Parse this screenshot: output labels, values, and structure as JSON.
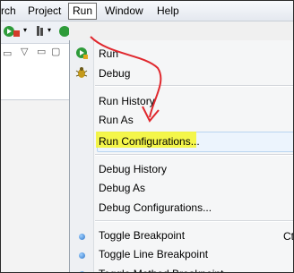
{
  "menubar": {
    "items": [
      {
        "label": "rch"
      },
      {
        "label": "Project"
      },
      {
        "label": "Run"
      },
      {
        "label": "Window"
      },
      {
        "label": "Help"
      }
    ]
  },
  "run_menu": {
    "groups": [
      [
        {
          "label": "Run",
          "icon": "run-icon"
        },
        {
          "label": "Debug",
          "icon": "debug-bug-icon"
        }
      ],
      [
        {
          "label": "Run History"
        },
        {
          "label": "Run As"
        },
        {
          "label": "Run Configurations...",
          "highlighted": true
        }
      ],
      [
        {
          "label": "Debug History"
        },
        {
          "label": "Debug As"
        },
        {
          "label": "Debug Configurations..."
        }
      ],
      [
        {
          "label": "Toggle Breakpoint",
          "accel": "Ct",
          "icon": "breakpoint-icon"
        },
        {
          "label": "Toggle Line Breakpoint",
          "icon": "breakpoint-icon"
        },
        {
          "label": "Toggle Method Breakpoint",
          "icon": "breakpoint-icon"
        }
      ]
    ]
  },
  "annotation": {
    "color": "#e0282e",
    "highlight_color": "#f6f62a"
  }
}
